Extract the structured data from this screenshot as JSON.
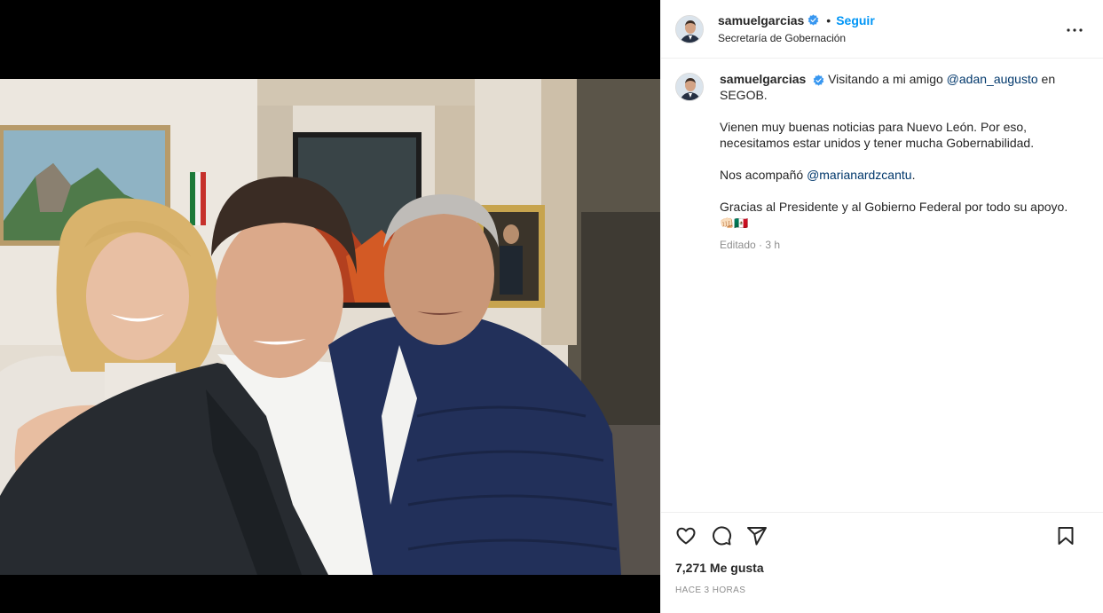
{
  "header": {
    "username": "samuelgarcias",
    "separator": "•",
    "follow_label": "Seguir",
    "location": "Secretaría de Gobernación"
  },
  "caption": {
    "username": "samuelgarcias",
    "line1_pre": "Visitando a mi amigo ",
    "line1_mention": "@adan_augusto",
    "line1_post": " en SEGOB.",
    "para2": "Vienen muy buenas noticias para Nuevo León. Por eso, necesitamos estar unidos y tener mucha Gobernabilidad.",
    "para3_pre": "Nos acompañó ",
    "para3_mention": "@marianardzcantu",
    "para3_post": ".",
    "para4": "Gracias al Presidente y al Gobierno Federal por todo su apoyo.",
    "emojis": "👊🏻🇲🇽",
    "meta": "Editado · 3 h"
  },
  "actions": {
    "likes": "7,271 Me gusta",
    "timestamp": "HACE 3 HORAS"
  },
  "icons": {
    "verified": "verified-badge-icon",
    "more": "more-options-icon",
    "like": "heart-icon",
    "comment": "comment-icon",
    "share": "share-icon",
    "save": "bookmark-icon"
  },
  "colors": {
    "link": "#00376b",
    "follow": "#0095f6",
    "verified": "#3897f0",
    "muted": "#8e8e8e"
  }
}
